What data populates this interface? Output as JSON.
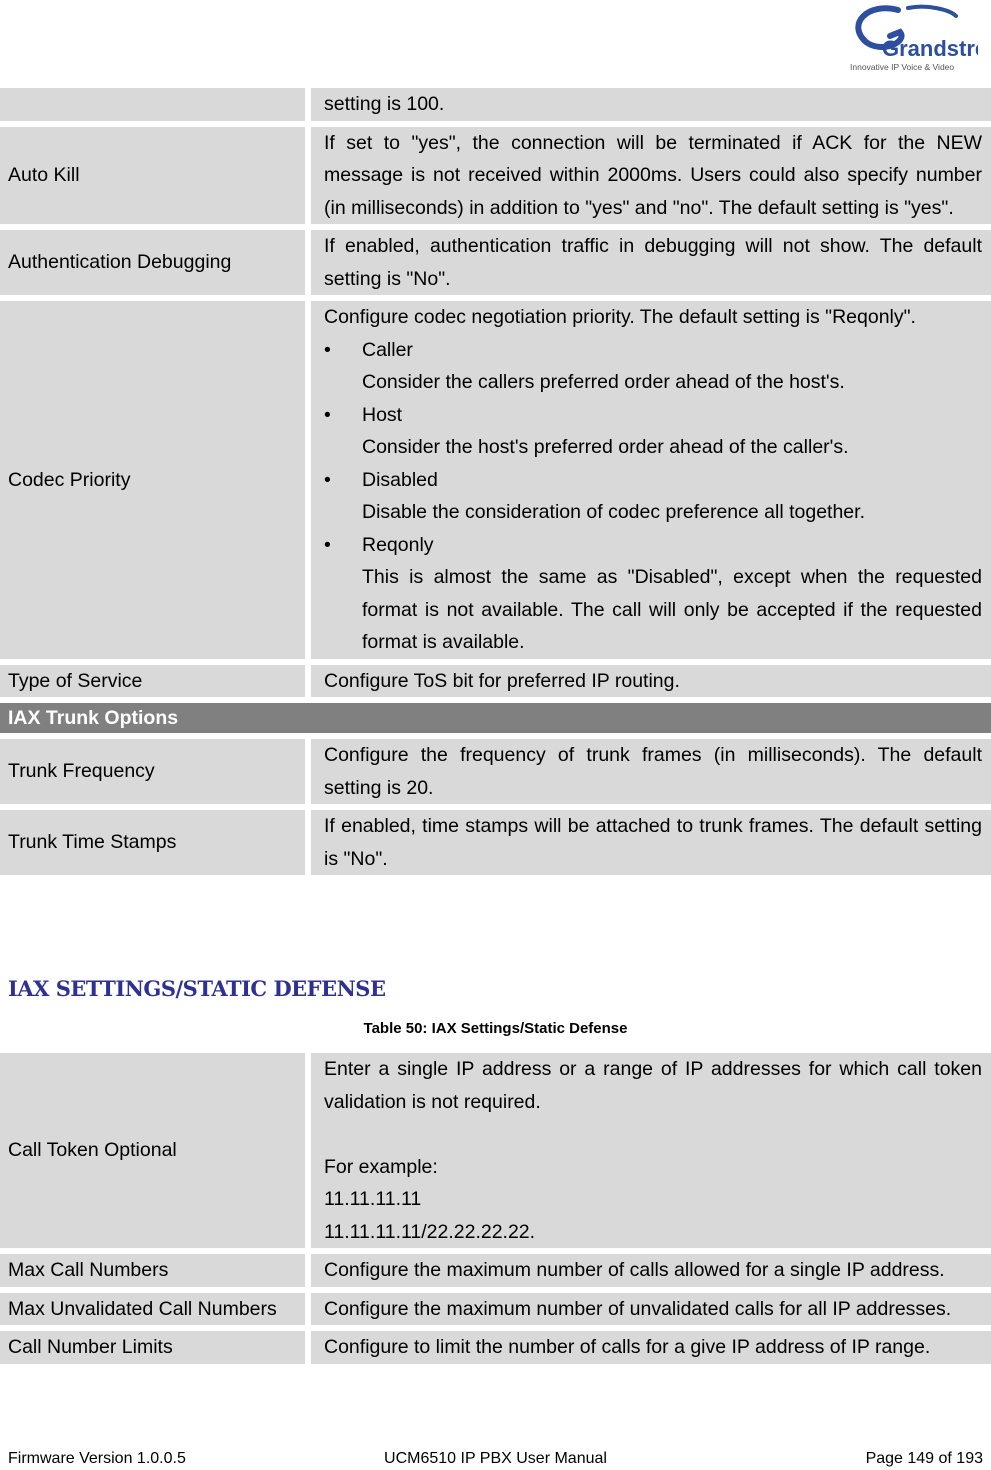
{
  "logo": {
    "brand": "Grandstream",
    "tagline": "Innovative IP Voice & Video"
  },
  "table_top": {
    "rows": [
      {
        "label": "",
        "desc": [
          "setting is 100."
        ]
      },
      {
        "label": "Auto Kill",
        "desc": [
          "If set to \"yes\", the connection will be terminated if ACK for the NEW message is not received within 2000ms. Users could also specify number (in milliseconds) in addition to \"yes\" and \"no\". The default setting is \"yes\"."
        ]
      },
      {
        "label": "Authentication Debugging",
        "desc": [
          "If enabled, authentication traffic in debugging will not show. The default setting is \"No\"."
        ]
      },
      {
        "label": "Codec Priority",
        "intro": "Configure codec negotiation priority. The default setting is \"Reqonly\".",
        "options": [
          {
            "name": "Caller",
            "text": "Consider the callers preferred order ahead of the host's."
          },
          {
            "name": "Host",
            "text": "Consider the host's preferred order ahead of the caller's."
          },
          {
            "name": "Disabled",
            "text": "Disable the consideration of codec preference all together."
          },
          {
            "name": "Reqonly",
            "text": "This is almost the same as \"Disabled\", except when the requested format is not available. The call will only be accepted if the requested format is available."
          }
        ]
      },
      {
        "label": "Type of Service",
        "desc": [
          "Configure ToS bit for preferred IP routing."
        ]
      }
    ],
    "section_header": "IAX Trunk Options",
    "trunk_rows": [
      {
        "label": "Trunk Frequency",
        "desc": "Configure the frequency of trunk frames (in milliseconds). The default setting is 20."
      },
      {
        "label": "Trunk Time Stamps",
        "desc": "If enabled, time stamps will be attached to trunk frames. The default setting is \"No\"."
      }
    ]
  },
  "section": {
    "heading": "IAX SETTINGS/STATIC DEFENSE",
    "caption": "Table 50: IAX Settings/Static Defense"
  },
  "table_bottom": {
    "call_token": {
      "label": "Call Token Optional",
      "line1": "Enter a single IP address or a range of IP addresses for which call token validation is not required.",
      "example_label": "For example:",
      "example1": "11.11.11.11",
      "example2": "11.11.11.11/22.22.22.22."
    },
    "rows": [
      {
        "label": "Max Call Numbers",
        "desc": "Configure the maximum number of calls allowed for a single IP address."
      },
      {
        "label": "Max Unvalidated Call Numbers",
        "desc": "Configure the maximum number of unvalidated calls for all IP addresses."
      },
      {
        "label": "Call Number Limits",
        "desc": "Configure to limit the number of calls for a give IP address of IP range."
      }
    ]
  },
  "footer": {
    "firmware": "Firmware Version 1.0.0.5",
    "manual": "UCM6510 IP PBX User Manual",
    "page": "Page 149 of 193"
  }
}
